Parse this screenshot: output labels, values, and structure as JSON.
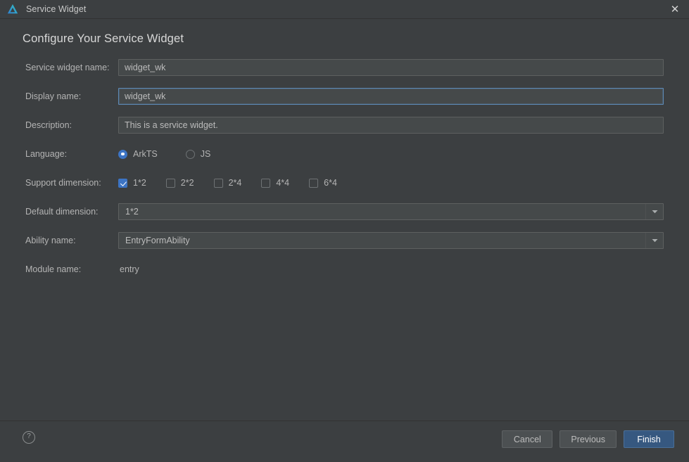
{
  "window": {
    "title": "Service Widget",
    "logo_icon": "deveco-logo-icon",
    "close_icon": "close-icon"
  },
  "dialog": {
    "heading": "Configure Your Service Widget"
  },
  "form": {
    "service_widget_name": {
      "label": "Service widget name:",
      "value": "widget_wk",
      "focused": false
    },
    "display_name": {
      "label": "Display name:",
      "value": "widget_wk",
      "focused": true
    },
    "description": {
      "label": "Description:",
      "value": "This is a service widget.",
      "focused": false
    },
    "language": {
      "label": "Language:",
      "options": [
        {
          "label": "ArkTS",
          "selected": true
        },
        {
          "label": "JS",
          "selected": false
        }
      ]
    },
    "support_dimension": {
      "label": "Support dimension:",
      "options": [
        {
          "label": "1*2",
          "checked": true
        },
        {
          "label": "2*2",
          "checked": false
        },
        {
          "label": "2*4",
          "checked": false
        },
        {
          "label": "4*4",
          "checked": false
        },
        {
          "label": "6*4",
          "checked": false
        }
      ]
    },
    "default_dimension": {
      "label": "Default dimension:",
      "value": "1*2",
      "arrow_icon": "chevron-down-icon"
    },
    "ability_name": {
      "label": "Ability name:",
      "value": "EntryFormAbility",
      "arrow_icon": "chevron-down-icon"
    },
    "module_name": {
      "label": "Module name:",
      "value": "entry"
    }
  },
  "footer": {
    "help_icon": "help-icon",
    "help_glyph": "?",
    "cancel_label": "Cancel",
    "previous_label": "Previous",
    "finish_label": "Finish"
  },
  "colors": {
    "background": "#3c3f41",
    "field_background": "#45494a",
    "accent": "#3c74c4",
    "primary_button": "#365880",
    "focus_border": "#5d89b5",
    "text": "#b4b4b4"
  }
}
